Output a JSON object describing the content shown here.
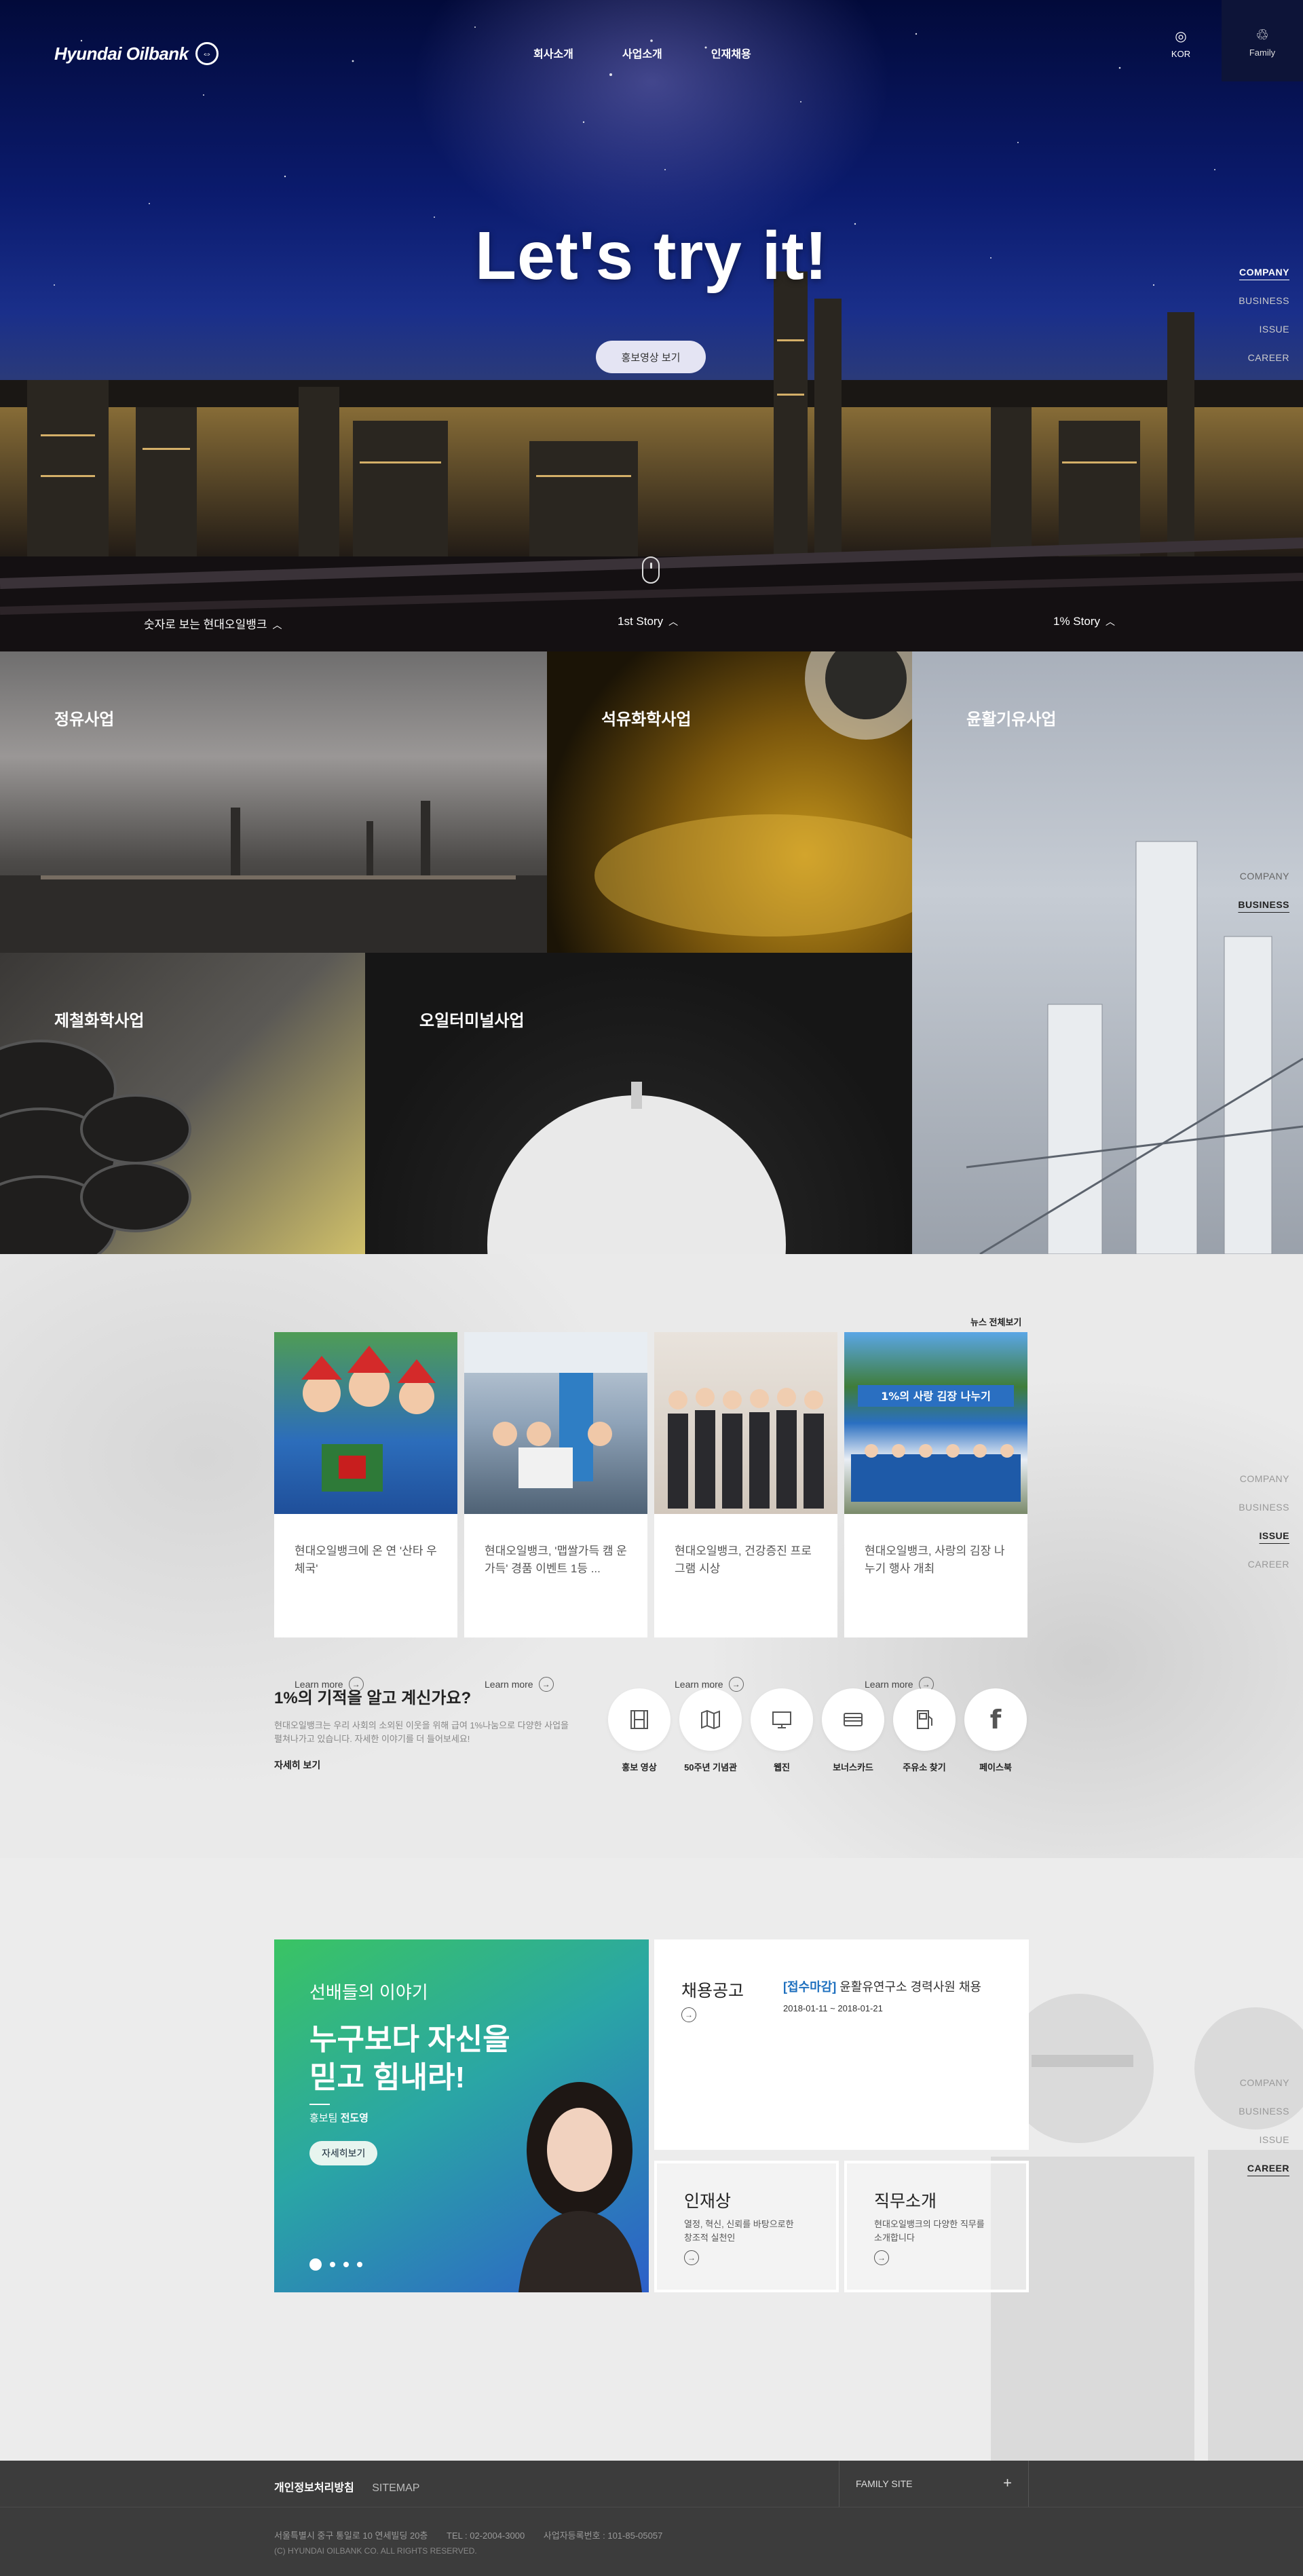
{
  "header": {
    "logo_text": "Hyundai Oilbank",
    "nav": [
      "회사소개",
      "사업소개",
      "인재채용"
    ],
    "lang_label": "KOR",
    "family_label": "Family"
  },
  "hero": {
    "title": "Let's try it!",
    "button_label": "홍보영상 보기",
    "stories": [
      "숫자로 보는 현대오일뱅크",
      "1st Story",
      "1% Story"
    ]
  },
  "side_nav": [
    "COMPANY",
    "BUSINESS",
    "ISSUE",
    "CAREER"
  ],
  "business": {
    "tiles": [
      "정유사업",
      "석유화학사업",
      "윤활기유사업",
      "제철화학사업",
      "오일터미널사업"
    ]
  },
  "news": {
    "all_link": "뉴스 전체보기",
    "cards": [
      {
        "title": "현대오일뱅크에 온 연 '산타 우체국'",
        "more": "Learn more"
      },
      {
        "title": "현대오일뱅크, '맵쌀가득 캠 운가득' 경품 이벤트 1등 ...",
        "more": "Learn more"
      },
      {
        "title": "현대오일뱅크, 건강증진 프로그램 시상",
        "more": "Learn more"
      },
      {
        "title": "현대오일뱅크, 사랑의 김장 나누기 행사 개최",
        "more": "Learn more"
      }
    ],
    "banner_text": "1%의 사랑 김장 나누기",
    "question": "1%의 기적을 알고 계신가요?",
    "desc": "현대오일뱅크는 우리 사회의 소외된 이웃을 위해 급여 1%나눔으로 다양한 사업을 펼쳐나가고 있습니다. 자세한 이야기를 더 들어보세요!",
    "more": "자세히 보기",
    "quick": [
      {
        "label": "홍보 영상",
        "icon": "film-icon"
      },
      {
        "label": "50주년 기념관",
        "icon": "map-icon"
      },
      {
        "label": "웹진",
        "icon": "monitor-icon"
      },
      {
        "label": "보너스카드",
        "icon": "card-icon"
      },
      {
        "label": "주유소 찾기",
        "icon": "fuel-icon"
      },
      {
        "label": "페이스북",
        "icon": "facebook-icon"
      }
    ]
  },
  "career": {
    "kicker": "선배들의 이야기",
    "headline_1": "누구보다 자신을",
    "headline_2": "믿고 힘내라!",
    "person_dept": "홍보팀",
    "person_name": "전도영",
    "detail_btn": "자세히보기",
    "recruit_title": "채용공고",
    "recruit_tag": "[접수마감]",
    "recruit_name": "윤활유연구소 경력사원 채용",
    "recruit_date": "2018-01-11 ~ 2018-01-21",
    "talent_title": "인재상",
    "talent_desc": "열정, 혁신, 신뢰를 바탕으로한 창조적 실천인",
    "job_title": "직무소개",
    "job_desc": "현대오일뱅크의 다양한 직무를 소개합니다"
  },
  "footer": {
    "privacy": "개인정보처리방침",
    "sitemap": "SITEMAP",
    "family_site": "FAMILY SITE",
    "plus": "+",
    "address": "서울특별시 중구 통일로 10 연세빌딩 20층",
    "tel": "TEL : 02-2004-3000",
    "bizno": "사업자등록번호 : 101-85-05057",
    "copyright": "(C) HYUNDAI OILBANK CO. ALL RIGHTS RESERVED."
  },
  "colors": {
    "accent_green": "#3ac463",
    "accent_blue": "#2d5fc9",
    "recruit_blue": "#1d6fbe",
    "footer_bg": "#3c3c3c"
  }
}
